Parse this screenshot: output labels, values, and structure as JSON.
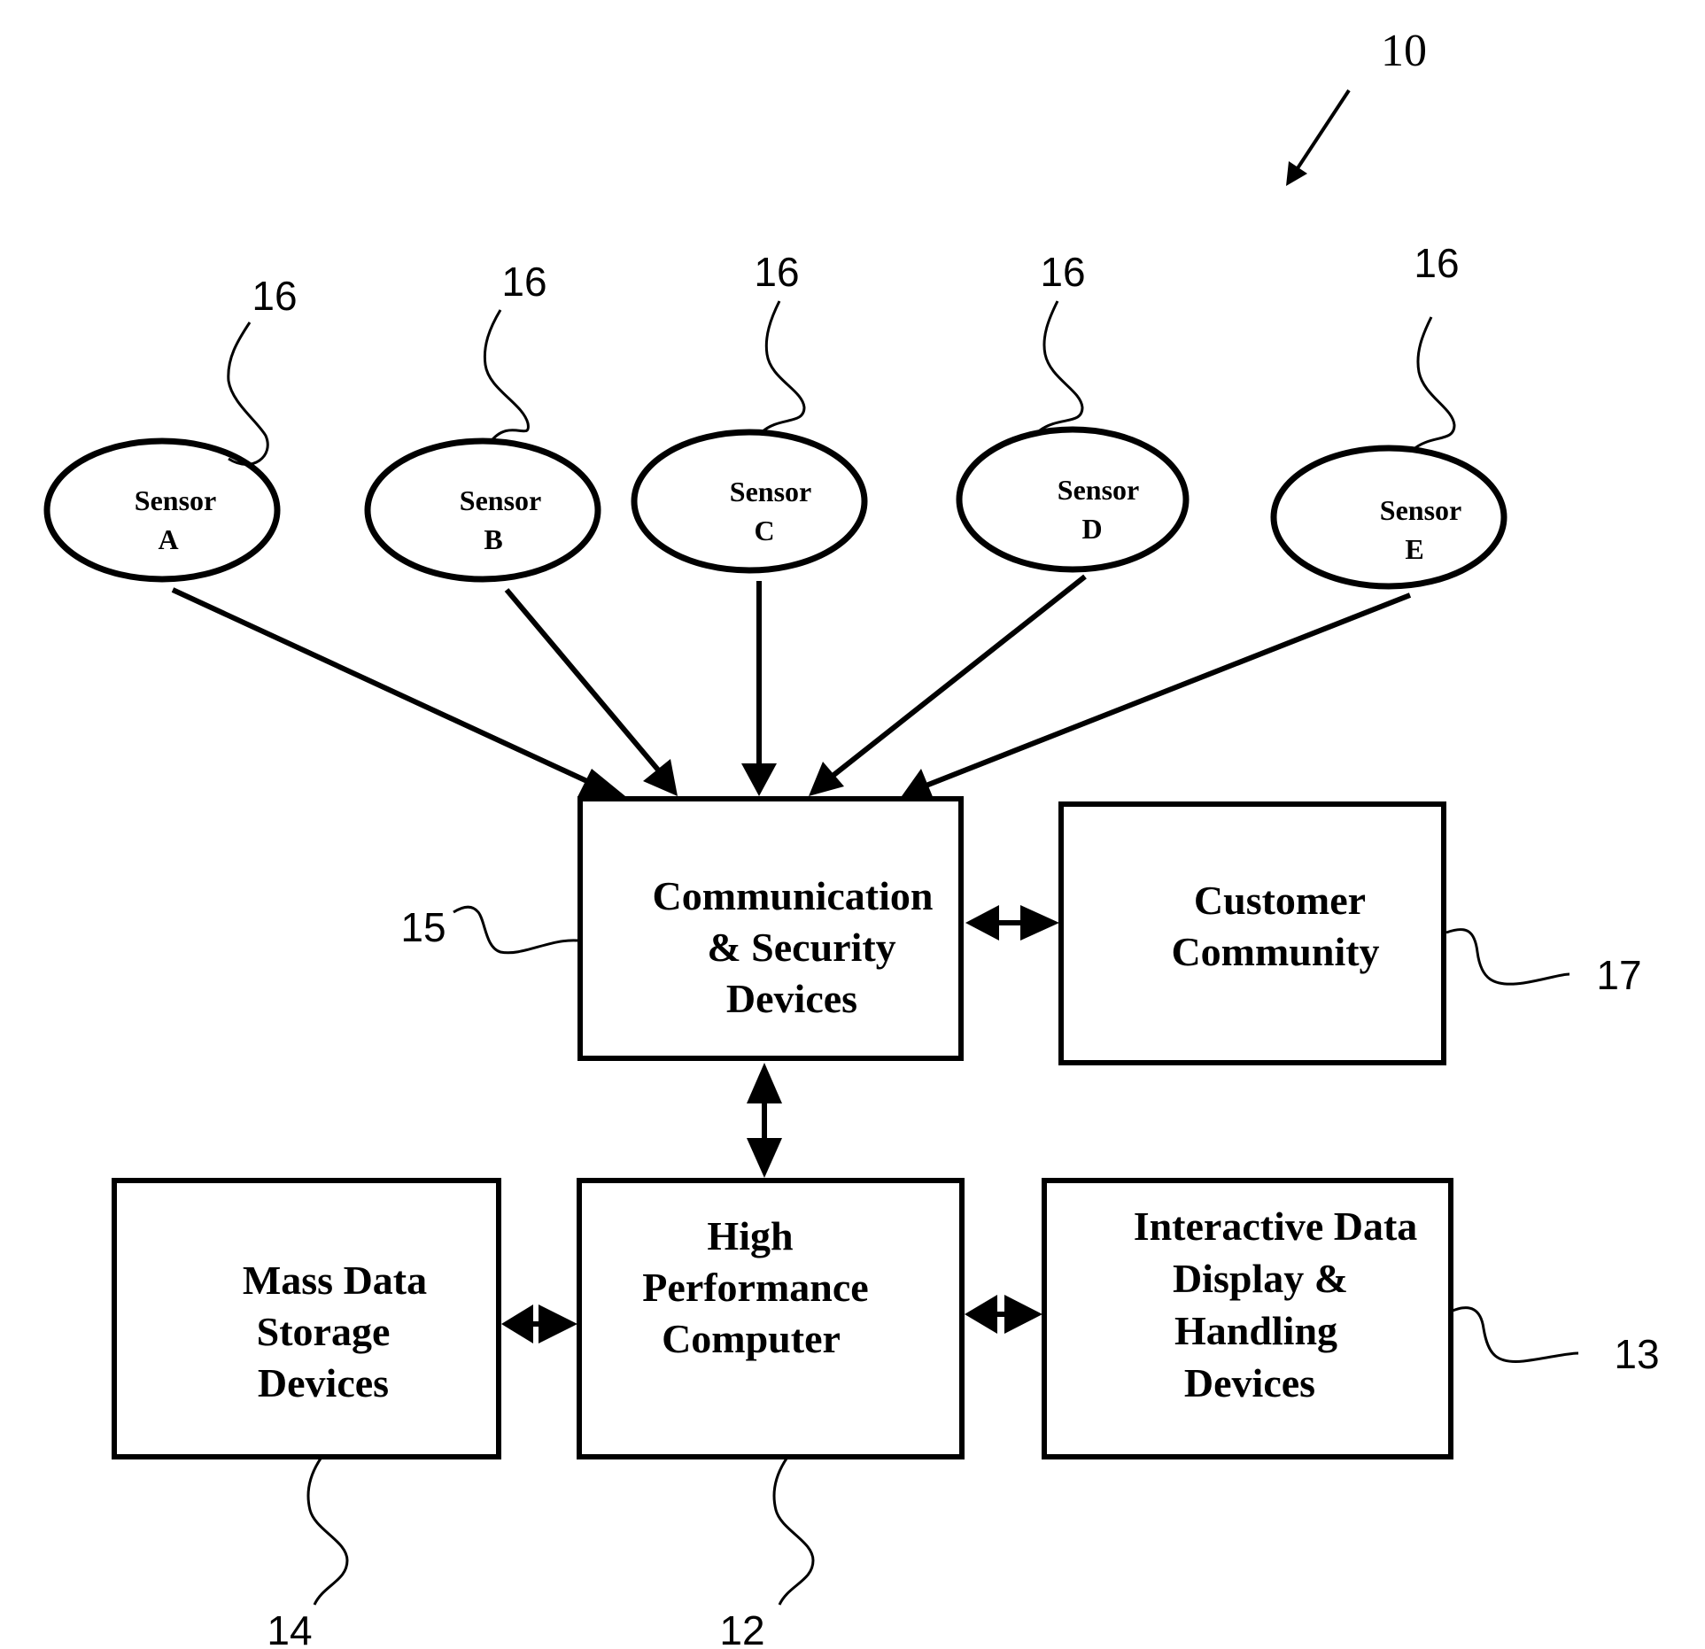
{
  "figure": {
    "reference_numeral": "10",
    "sensors": [
      {
        "id": "A",
        "line1": "Sensor",
        "line2": "A",
        "ref": "16"
      },
      {
        "id": "B",
        "line1": "Sensor",
        "line2": "B",
        "ref": "16"
      },
      {
        "id": "C",
        "line1": "Sensor",
        "line2": "C",
        "ref": "16"
      },
      {
        "id": "D",
        "line1": "Sensor",
        "line2": "D",
        "ref": "16"
      },
      {
        "id": "E",
        "line1": "Sensor",
        "line2": "E",
        "ref": "16"
      }
    ],
    "blocks": {
      "communication": {
        "lines": [
          "Communication",
          "& Security",
          "Devices"
        ],
        "ref": "15"
      },
      "customer": {
        "lines": [
          "Customer",
          "Community"
        ],
        "ref": "17"
      },
      "storage": {
        "lines": [
          "Mass Data",
          "Storage",
          "Devices"
        ],
        "ref": "14"
      },
      "computer": {
        "lines": [
          "High",
          "Performance",
          "Computer"
        ],
        "ref": "12"
      },
      "display": {
        "lines": [
          "Interactive Data",
          "Display &",
          "Handling",
          "Devices"
        ],
        "ref": "13"
      }
    },
    "connections": [
      {
        "from": "sensor-A",
        "to": "communication",
        "direction": "one-way"
      },
      {
        "from": "sensor-B",
        "to": "communication",
        "direction": "one-way"
      },
      {
        "from": "sensor-C",
        "to": "communication",
        "direction": "one-way"
      },
      {
        "from": "sensor-D",
        "to": "communication",
        "direction": "one-way"
      },
      {
        "from": "sensor-E",
        "to": "communication",
        "direction": "one-way"
      },
      {
        "from": "communication",
        "to": "customer",
        "direction": "two-way"
      },
      {
        "from": "communication",
        "to": "computer",
        "direction": "two-way"
      },
      {
        "from": "storage",
        "to": "computer",
        "direction": "two-way"
      },
      {
        "from": "computer",
        "to": "display",
        "direction": "two-way"
      }
    ]
  }
}
